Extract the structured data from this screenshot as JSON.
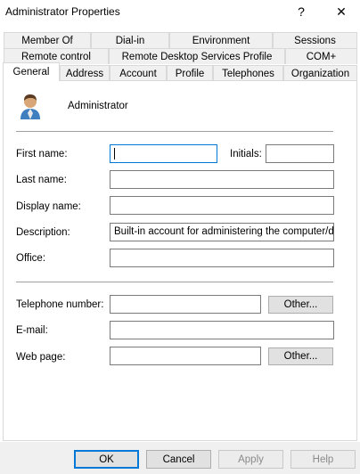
{
  "window": {
    "title": "Administrator Properties"
  },
  "titlebar": {
    "help_glyph": "?",
    "close_glyph": "✕"
  },
  "tabs": {
    "row1": [
      "Member Of",
      "Dial-in",
      "Environment",
      "Sessions"
    ],
    "row2": [
      "Remote control",
      "Remote Desktop Services Profile",
      "COM+"
    ],
    "row3": [
      "General",
      "Address",
      "Account",
      "Profile",
      "Telephones",
      "Organization"
    ],
    "active": "General"
  },
  "general": {
    "user_icon": "user-icon",
    "user_name": "Administrator",
    "first_name": {
      "label": "First name:",
      "value": ""
    },
    "initials": {
      "label": "Initials:",
      "value": ""
    },
    "last_name": {
      "label": "Last name:",
      "value": ""
    },
    "display_name": {
      "label": "Display name:",
      "value": ""
    },
    "description": {
      "label": "Description:",
      "value": "Built-in account for administering the computer/doma"
    },
    "office": {
      "label": "Office:",
      "value": ""
    },
    "telephone": {
      "label": "Telephone number:",
      "value": "",
      "other_label": "Other..."
    },
    "email": {
      "label": "E-mail:",
      "value": ""
    },
    "web_page": {
      "label": "Web page:",
      "value": "",
      "other_label": "Other..."
    }
  },
  "buttons": {
    "ok": "OK",
    "cancel": "Cancel",
    "apply": "Apply",
    "help": "Help"
  },
  "colors": {
    "accent": "#0078d7",
    "border": "#d9d9d9",
    "panel": "#ffffff"
  }
}
